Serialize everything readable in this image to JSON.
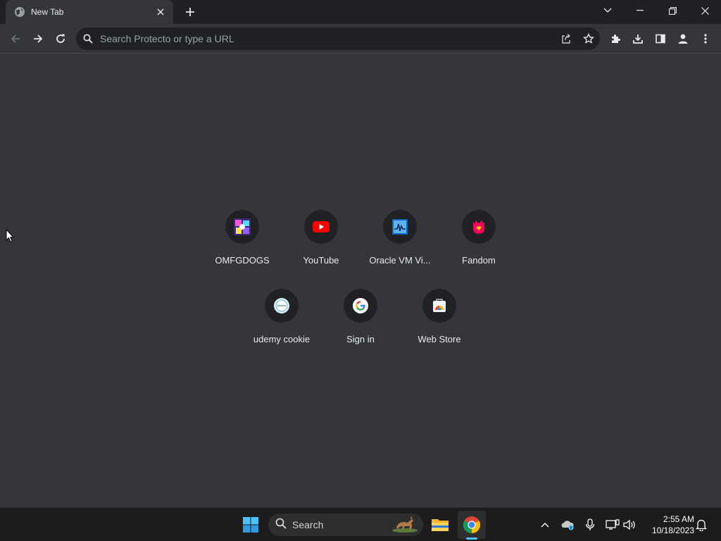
{
  "browser": {
    "tab": {
      "title": "New Tab",
      "favicon": "globe-icon"
    },
    "omnibox": {
      "placeholder": "Search Protecto or type a URL",
      "value": ""
    }
  },
  "shortcuts": [
    {
      "title": "OMFGDOGS",
      "icon": "omfgdogs-favicon"
    },
    {
      "title": "YouTube",
      "icon": "youtube-favicon"
    },
    {
      "title": "Oracle VM Vi...",
      "icon": "virtualbox-favicon"
    },
    {
      "title": "Fandom",
      "icon": "fandom-favicon"
    },
    {
      "title": "udemy cookie",
      "icon": "udemy-favicon"
    },
    {
      "title": "Sign in",
      "icon": "google-favicon"
    },
    {
      "title": "Web Store",
      "icon": "webstore-favicon"
    }
  ],
  "taskbar": {
    "search_label": "Search",
    "clock": {
      "time": "2:55 AM",
      "date": "10/18/2023"
    }
  },
  "colors": {
    "page_bg": "#35363a",
    "titlebar_bg": "#202124",
    "taskbar_bg": "#1c1c1c",
    "accent": "#4cc2ff"
  }
}
